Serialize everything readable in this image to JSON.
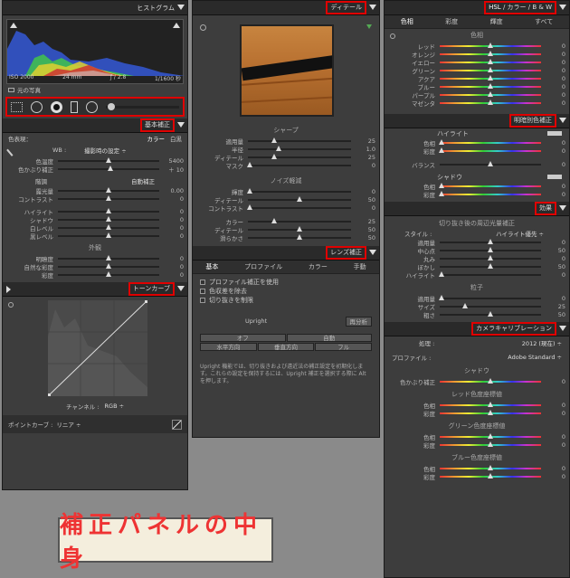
{
  "left": {
    "histogram_title": "ヒストグラム",
    "exif": [
      "ISO 2000",
      "24 mm",
      "ƒ / 2.8",
      "1/1600 秒"
    ],
    "original_photo": "元の写真",
    "basic_title": "基本補正",
    "color_mode": "色表現：",
    "color": "カラー",
    "bw": "白黒",
    "wb_label": "WB :",
    "wb_value": "撮影時の設定 ÷",
    "wb_sliders": [
      {
        "label": "色温度",
        "value": "5400",
        "pos": 0.5
      },
      {
        "label": "色かぶり補正",
        "value": "＋ 10",
        "pos": 0.52
      }
    ],
    "tone_label": "階調",
    "auto": "自動補正",
    "tone_sliders": [
      {
        "label": "露光量",
        "value": "0.00",
        "pos": 0.5
      },
      {
        "label": "コントラスト",
        "value": "0",
        "pos": 0.5
      }
    ],
    "tone_sliders2": [
      {
        "label": "ハイライト",
        "value": "0",
        "pos": 0.5
      },
      {
        "label": "シャドウ",
        "value": "0",
        "pos": 0.5
      },
      {
        "label": "白レベル",
        "value": "0",
        "pos": 0.5
      },
      {
        "label": "黒レベル",
        "value": "0",
        "pos": 0.5
      }
    ],
    "presence_label": "外観",
    "presence_sliders": [
      {
        "label": "明瞭度",
        "value": "0",
        "pos": 0.5
      },
      {
        "label": "自然な彩度",
        "value": "0",
        "pos": 0.5
      },
      {
        "label": "彩度",
        "value": "0",
        "pos": 0.5
      }
    ],
    "tonecurve_title": "トーンカーブ",
    "channel_label": "チャンネル :",
    "channel_value": "RGB ÷",
    "point_curve_label": "ポイントカーブ :",
    "point_curve_value": "リニア ÷"
  },
  "mid": {
    "detail_title": "ディテール",
    "sharp_label": "シャープ",
    "sharp_sliders": [
      {
        "label": "適用量",
        "value": "25",
        "pos": 0.25
      },
      {
        "label": "半径",
        "value": "1.0",
        "pos": 0.3
      },
      {
        "label": "ディテール",
        "value": "25",
        "pos": 0.25
      },
      {
        "label": "マスク",
        "value": "0",
        "pos": 0.02
      }
    ],
    "noise_label": "ノイズ軽減",
    "noise_sliders": [
      {
        "label": "輝度",
        "value": "0",
        "pos": 0.02
      },
      {
        "label": "ディテール",
        "value": "50",
        "pos": 0.5
      },
      {
        "label": "コントラスト",
        "value": "0",
        "pos": 0.02
      }
    ],
    "noise_sliders2": [
      {
        "label": "カラー",
        "value": "25",
        "pos": 0.25
      },
      {
        "label": "ディテール",
        "value": "50",
        "pos": 0.5
      },
      {
        "label": "滑らかさ",
        "value": "50",
        "pos": 0.5
      }
    ],
    "lens_title": "レンズ補正",
    "tabs": [
      "基本",
      "プロファイル",
      "カラー",
      "手動"
    ],
    "checks": [
      "プロファイル補正を使用",
      "色収差を除去",
      "切り抜きを制限"
    ],
    "upright": "Upright",
    "reanalyze": "再分析",
    "btns1": [
      "オフ",
      "自動"
    ],
    "btns2": [
      "水平方向",
      "垂直方向",
      "フル"
    ],
    "note": "Upright 機能では、切り抜きおよび遠近法の補正設定を初期化します。これらの設定を保持するには、Upright 補正を選択する際に Alt を押します。"
  },
  "right": {
    "hsl_title": "HSL",
    "hsl_sep1": "/",
    "hsl_color": "カラー",
    "hsl_sep2": "/",
    "hsl_bw": "B & W",
    "tabs": [
      "色相",
      "彩度",
      "輝度",
      "すべて"
    ],
    "hue_label": "色相",
    "hue_sliders": [
      {
        "label": "レッド",
        "value": "0",
        "pos": 0.5
      },
      {
        "label": "オレンジ",
        "value": "0",
        "pos": 0.5
      },
      {
        "label": "イエロー",
        "value": "0",
        "pos": 0.5
      },
      {
        "label": "グリーン",
        "value": "0",
        "pos": 0.5
      },
      {
        "label": "アクア",
        "value": "0",
        "pos": 0.5
      },
      {
        "label": "ブルー",
        "value": "0",
        "pos": 0.5
      },
      {
        "label": "パープル",
        "value": "0",
        "pos": 0.5
      },
      {
        "label": "マゼンタ",
        "value": "0",
        "pos": 0.5
      }
    ],
    "split_title": "明暗別色補正",
    "highlight_label": "ハイライト",
    "split_h": [
      {
        "label": "色相",
        "value": "0",
        "pos": 0.02
      },
      {
        "label": "彩度",
        "value": "0",
        "pos": 0.02
      }
    ],
    "balance": {
      "label": "バランス",
      "value": "0",
      "pos": 0.5
    },
    "shadow_label": "シャドウ",
    "split_s": [
      {
        "label": "色相",
        "value": "0",
        "pos": 0.02
      },
      {
        "label": "彩度",
        "value": "0",
        "pos": 0.02
      }
    ],
    "effects_title": "効果",
    "vignette_label": "切り抜き後の周辺光量補正",
    "style_label": "スタイル :",
    "style_value": "ハイライト優先 ÷",
    "vignette_sliders": [
      {
        "label": "適用量",
        "value": "0",
        "pos": 0.5
      },
      {
        "label": "中心点",
        "value": "50",
        "pos": 0.5
      },
      {
        "label": "丸み",
        "value": "0",
        "pos": 0.5
      },
      {
        "label": "ぼかし",
        "value": "50",
        "pos": 0.5
      },
      {
        "label": "ハイライト",
        "value": "0",
        "pos": 0.02
      }
    ],
    "grain_label": "粒子",
    "grain_sliders": [
      {
        "label": "適用量",
        "value": "0",
        "pos": 0.02
      },
      {
        "label": "サイズ",
        "value": "25",
        "pos": 0.25
      },
      {
        "label": "粗さ",
        "value": "50",
        "pos": 0.5
      }
    ],
    "calib_title": "カメラキャリブレーション",
    "process_label": "処理 :",
    "process_value": "2012 (現在) ÷",
    "profile_label": "プロファイル :",
    "profile_value": "Adobe Standard ÷",
    "shadow2_label": "シャドウ",
    "tint": {
      "label": "色かぶり補正",
      "value": "0",
      "pos": 0.5
    },
    "red_label": "レッド色度座標値",
    "red": [
      {
        "label": "色相",
        "value": "0",
        "pos": 0.5
      },
      {
        "label": "彩度",
        "value": "0",
        "pos": 0.5
      }
    ],
    "green_label": "グリーン色度座標値",
    "green": [
      {
        "label": "色相",
        "value": "0",
        "pos": 0.5
      },
      {
        "label": "彩度",
        "value": "0",
        "pos": 0.5
      }
    ],
    "blue_label": "ブルー色度座標値",
    "blue": [
      {
        "label": "色相",
        "value": "0",
        "pos": 0.5
      },
      {
        "label": "彩度",
        "value": "0",
        "pos": 0.5
      }
    ]
  },
  "caption": "補正パネルの中身"
}
